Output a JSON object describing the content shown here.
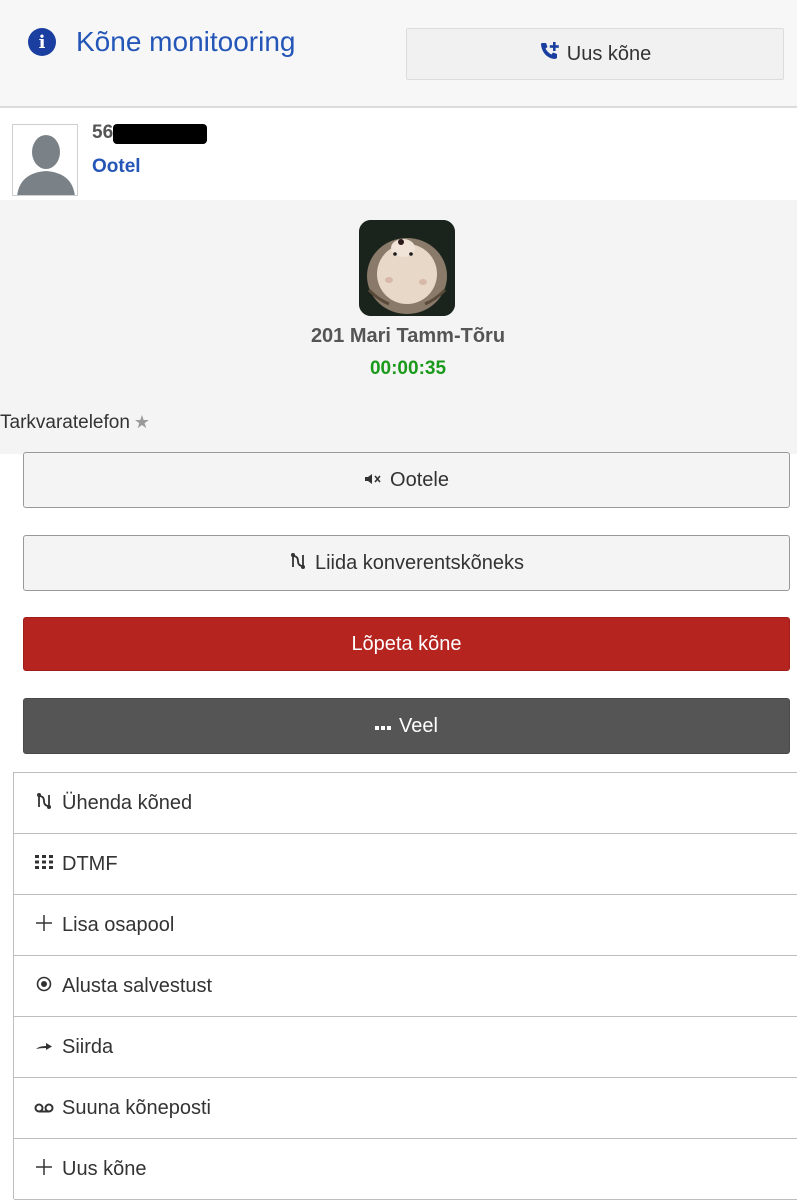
{
  "header": {
    "title": "Kõne monitooring",
    "info_icon": "i",
    "new_call_icon": "phone-plus-icon",
    "new_call_label": "Uus kõne"
  },
  "caller": {
    "number": "56",
    "status": "Ootel"
  },
  "agent": {
    "name": "201 Mari Tamm-Tõru",
    "timer": "00:00:35"
  },
  "device": {
    "label": "Tarkvaratelefon"
  },
  "actions": {
    "hold_label": "Ootele",
    "conference_label": "Liida konverentskõneks",
    "end_label": "Lõpeta kõne",
    "more_label": "Veel"
  },
  "menu": {
    "items": [
      {
        "label": "Ühenda kõned",
        "icon": "merge-icon"
      },
      {
        "label": "DTMF",
        "icon": "keypad-icon"
      },
      {
        "label": "Lisa osapool",
        "icon": "plus-icon"
      },
      {
        "label": "Alusta salvestust",
        "icon": "record-icon"
      },
      {
        "label": "Siirda",
        "icon": "transfer-arrow-icon"
      },
      {
        "label": "Suuna kõneposti",
        "icon": "voicemail-icon"
      },
      {
        "label": "Uus kõne",
        "icon": "plus-icon"
      }
    ]
  },
  "colors": {
    "accent": "#2456b8",
    "end_call": "#b5241f",
    "more": "#555555",
    "timer": "#1a9a1a"
  }
}
